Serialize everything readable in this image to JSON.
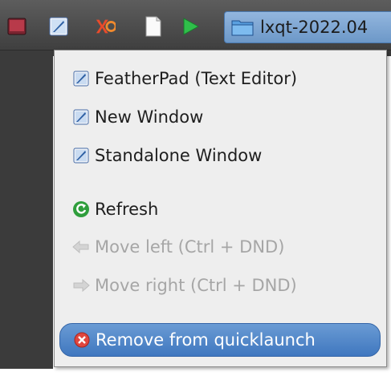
{
  "taskbar": {
    "task_window_title": "lxqt-2022.04"
  },
  "menu": {
    "items": [
      {
        "label": "FeatherPad (Text Editor)",
        "icon": "featherpad-icon",
        "state": "normal"
      },
      {
        "label": "New Window",
        "icon": "featherpad-icon",
        "state": "normal"
      },
      {
        "label": "Standalone Window",
        "icon": "featherpad-icon",
        "state": "normal"
      },
      {
        "label": "Refresh",
        "icon": "refresh-icon",
        "state": "normal"
      },
      {
        "label": "Move left (Ctrl + DND)",
        "icon": "arrow-left-icon",
        "state": "disabled"
      },
      {
        "label": "Move right (Ctrl + DND)",
        "icon": "arrow-right-icon",
        "state": "disabled"
      },
      {
        "label": "Remove from quicklaunch",
        "icon": "remove-icon",
        "state": "selected"
      }
    ]
  },
  "colors": {
    "highlight": "#3f77bf",
    "disabled_text": "#a6a6a6",
    "menu_background": "#eeeeee",
    "taskbar": "#4a4a4a"
  }
}
